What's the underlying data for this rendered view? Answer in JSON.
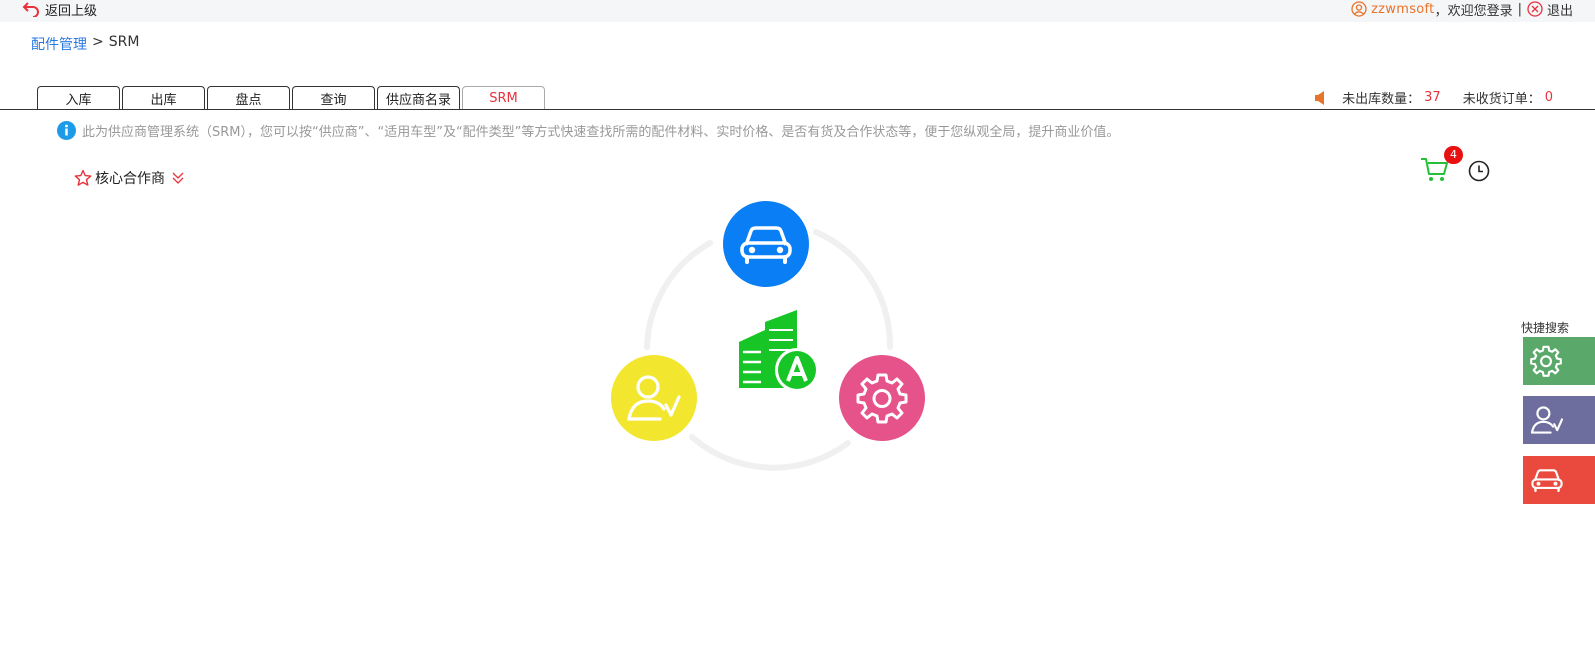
{
  "header": {
    "back_label": "返回上级",
    "username": "zzwmsoft",
    "welcome": "，欢迎您登录",
    "separator": "|",
    "logout_label": "退出"
  },
  "breadcrumb": {
    "parent": "配件管理",
    "divider": ">",
    "current": "SRM"
  },
  "tabs": [
    {
      "label": "入库",
      "active": false
    },
    {
      "label": "出库",
      "active": false
    },
    {
      "label": "盘点",
      "active": false
    },
    {
      "label": "查询",
      "active": false
    },
    {
      "label": "供应商名录",
      "active": false
    },
    {
      "label": "SRM",
      "active": true
    }
  ],
  "stats": {
    "unshipped_label": "未出库数量：",
    "unshipped_value": "37",
    "unreceived_label": "未收货订单：",
    "unreceived_value": "0"
  },
  "notice": "此为供应商管理系统（SRM），您可以按“供应商”、“适用车型”及“配件类型”等方式快速查找所需的配件材料、实时价格、是否有货及合作状态等，便于您纵观全局，提升商业价值。",
  "core_partner_label": "核心合作商",
  "cart": {
    "count": "4"
  },
  "quick_search": {
    "label": "快捷搜索"
  },
  "colors": {
    "accent_red": "#e8323c",
    "link_blue": "#2a7ae2",
    "car_blue": "#0a7ff5",
    "user_yellow": "#f2e72e",
    "gear_pink": "#e6528a",
    "building_green": "#17c626",
    "quick_green": "#5aa86a",
    "quick_purple": "#6e6e9e",
    "quick_red": "#e94a3d"
  },
  "icons": [
    "back-arrow-icon",
    "user-icon",
    "close-circle-icon",
    "speaker-icon",
    "info-icon",
    "star-icon",
    "chevron-double-down-icon",
    "cart-icon",
    "clock-icon",
    "car-icon",
    "user-check-icon",
    "gear-icon",
    "building-icon"
  ]
}
